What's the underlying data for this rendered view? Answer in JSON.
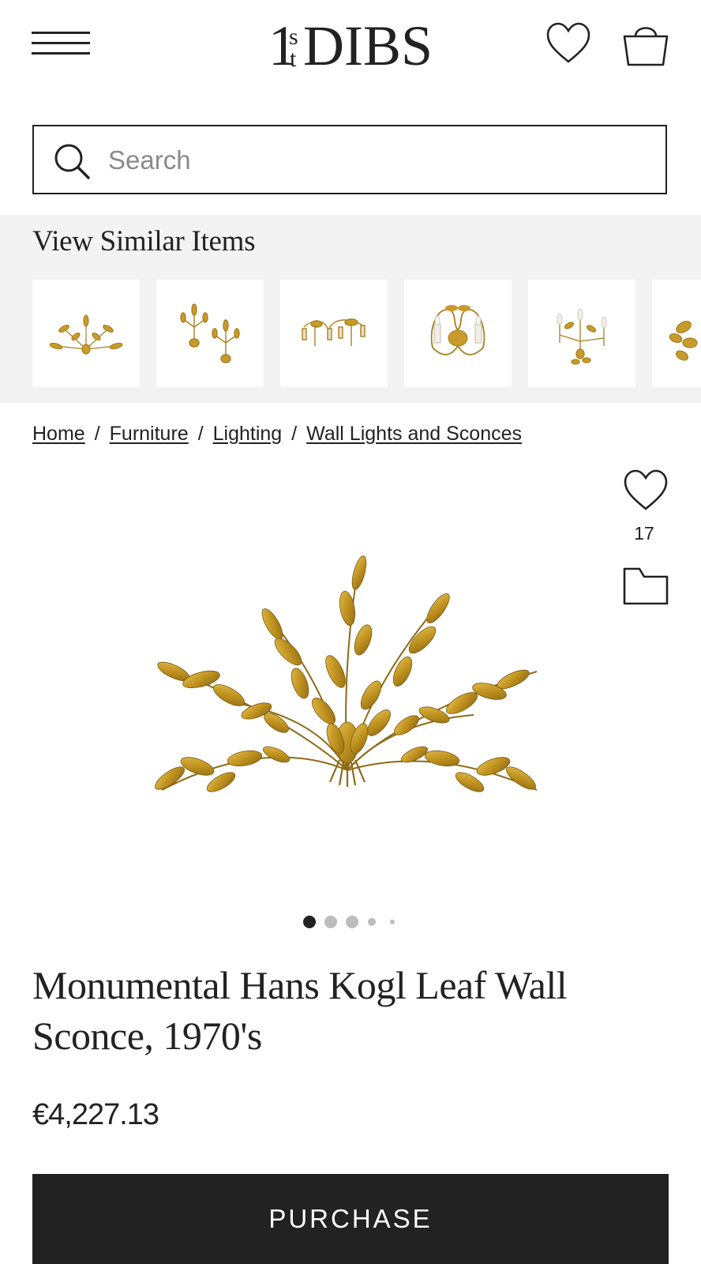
{
  "header": {
    "logo_text": "1stDIBS"
  },
  "search": {
    "placeholder": "Search"
  },
  "similar_items": {
    "title": "View Similar Items"
  },
  "breadcrumb": {
    "items": [
      "Home",
      "Furniture",
      "Lighting",
      "Wall Lights and Sconces"
    ],
    "separator": "/"
  },
  "favorites": {
    "count": "17"
  },
  "product": {
    "title": "Monumental Hans Kogl Leaf Wall Sconce, 1970's",
    "price": "€4,227.13",
    "purchase_label": "PURCHASE"
  },
  "gallery": {
    "current_index": 1
  },
  "colors": {
    "primary": "#222222",
    "gold": "#c89b2c",
    "panel_bg": "#f3f3f3"
  }
}
